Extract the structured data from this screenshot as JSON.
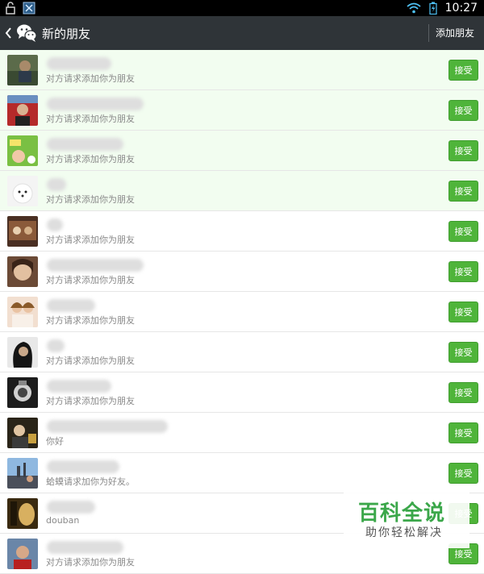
{
  "status_bar": {
    "time": "10:27",
    "icons": [
      "lock-icon",
      "notification-app-icon",
      "wifi-icon",
      "battery-icon"
    ]
  },
  "app_bar": {
    "title": "新的朋友",
    "add_friend": "添加朋友"
  },
  "list": [
    {
      "subtext": "对方请求添加你为朋友",
      "accept": "接受"
    },
    {
      "subtext": "对方请求添加你为朋友",
      "accept": "接受"
    },
    {
      "subtext": "对方请求添加你为朋友",
      "accept": "接受"
    },
    {
      "subtext": "对方请求添加你为朋友",
      "accept": "接受"
    },
    {
      "subtext": "对方请求添加你为朋友",
      "accept": "接受"
    },
    {
      "subtext": "对方请求添加你为朋友",
      "accept": "接受"
    },
    {
      "subtext": "对方请求添加你为朋友",
      "accept": "接受"
    },
    {
      "subtext": "对方请求添加你为朋友",
      "accept": "接受"
    },
    {
      "subtext": "对方请求添加你为朋友",
      "accept": "接受"
    },
    {
      "subtext": "你好",
      "accept": "接受"
    },
    {
      "subtext": "蛤蟆请求加你为好友。",
      "accept": "接受"
    },
    {
      "subtext": "douban",
      "accept": "接受"
    },
    {
      "subtext": "对方请求添加你为朋友",
      "accept": "接受"
    }
  ],
  "watermark": {
    "title": "百科全说",
    "subtitle": "助你轻松解决"
  },
  "colors": {
    "accept_green": "#4fb43a",
    "app_bar": "#2f3438",
    "highlight_row": "#f2fdf0"
  }
}
